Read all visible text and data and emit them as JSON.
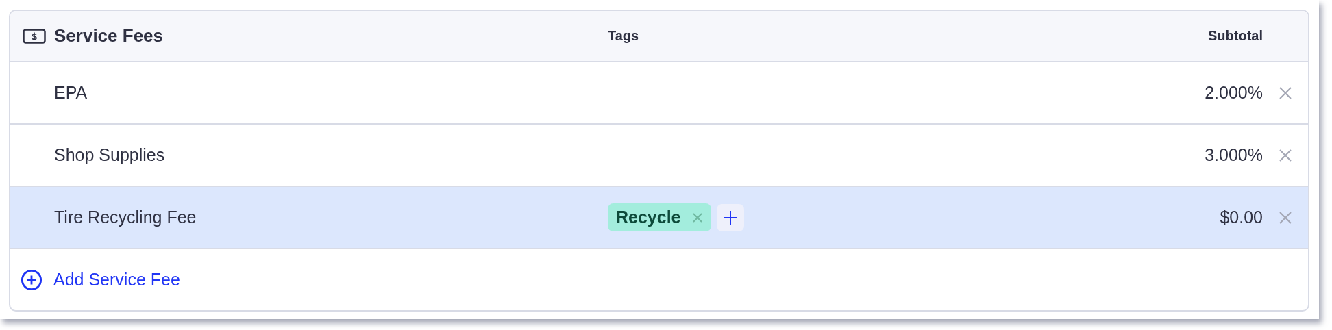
{
  "header": {
    "title": "Service Fees",
    "columns": [
      "Tags",
      "Subtotal"
    ]
  },
  "rows": [
    {
      "name": "EPA",
      "tags": [],
      "subtotal": "2.000%",
      "selected": false
    },
    {
      "name": "Shop Supplies",
      "tags": [],
      "subtotal": "3.000%",
      "selected": false
    },
    {
      "name": "Tire Recycling Fee",
      "tags": [
        {
          "label": "Recycle"
        }
      ],
      "subtotal": "$0.00",
      "selected": true
    }
  ],
  "add_button": {
    "label": "Add Service Fee"
  }
}
